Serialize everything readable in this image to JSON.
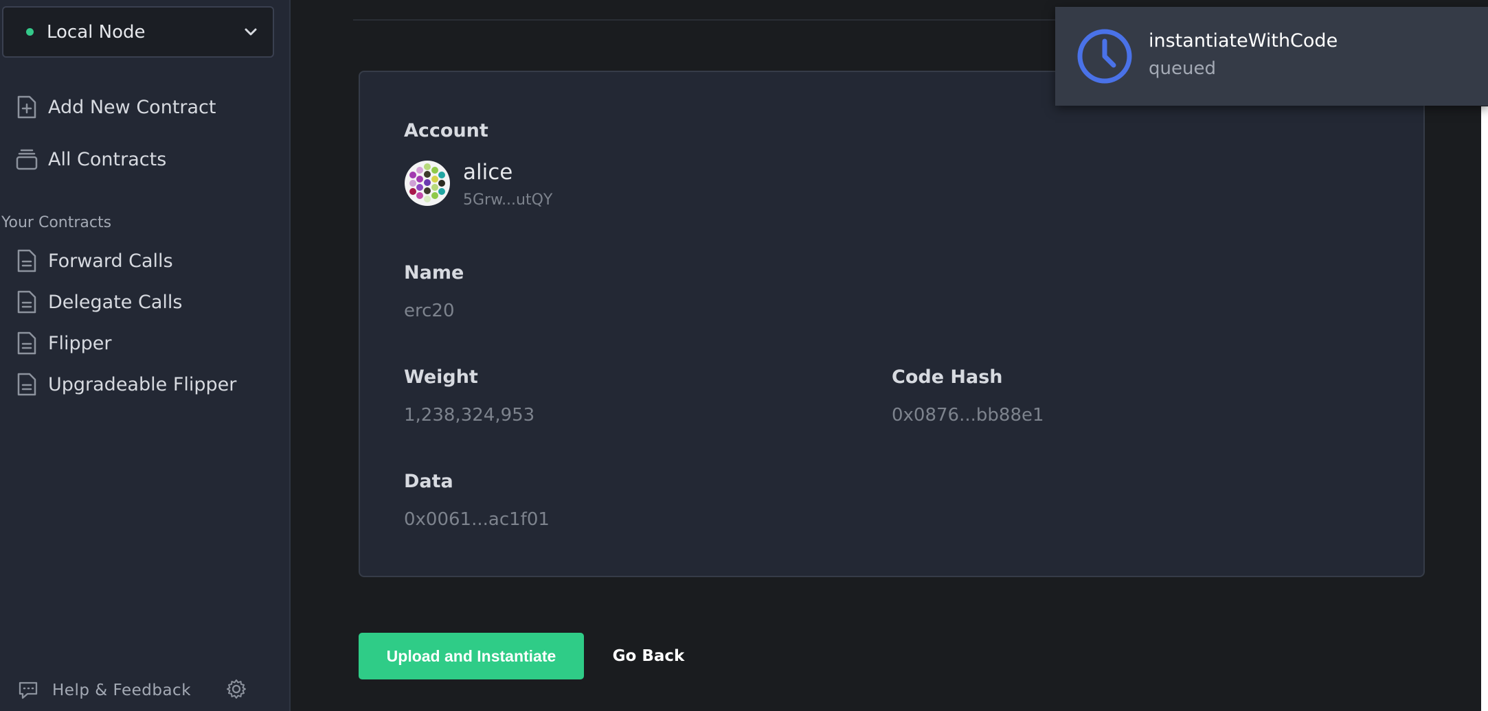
{
  "network": {
    "name": "Local Node",
    "status_color": "#34c98a"
  },
  "nav": {
    "add_contract": "Add New Contract",
    "all_contracts": "All Contracts"
  },
  "contracts_section": {
    "title": "Your Contracts",
    "items": [
      "Forward Calls",
      "Delegate Calls",
      "Flipper",
      "Upgradeable Flipper"
    ]
  },
  "footer": {
    "help": "Help & Feedback"
  },
  "review": {
    "account_label": "Account",
    "account_name": "alice",
    "account_address": "5Grw...utQY",
    "name_label": "Name",
    "name_value": "erc20",
    "weight_label": "Weight",
    "weight_value": "1,238,324,953",
    "code_hash_label": "Code Hash",
    "code_hash_value": "0x0876...bb88e1",
    "data_label": "Data",
    "data_value": "0x0061...ac1f01"
  },
  "actions": {
    "primary": "Upload and Instantiate",
    "secondary": "Go Back"
  },
  "toast": {
    "title": "instantiateWithCode",
    "status": "queued",
    "accent": "#4a72e8"
  },
  "colors": {
    "accent_green": "#2fcc87",
    "bg": "#1a1c1f",
    "panel": "#232834"
  }
}
